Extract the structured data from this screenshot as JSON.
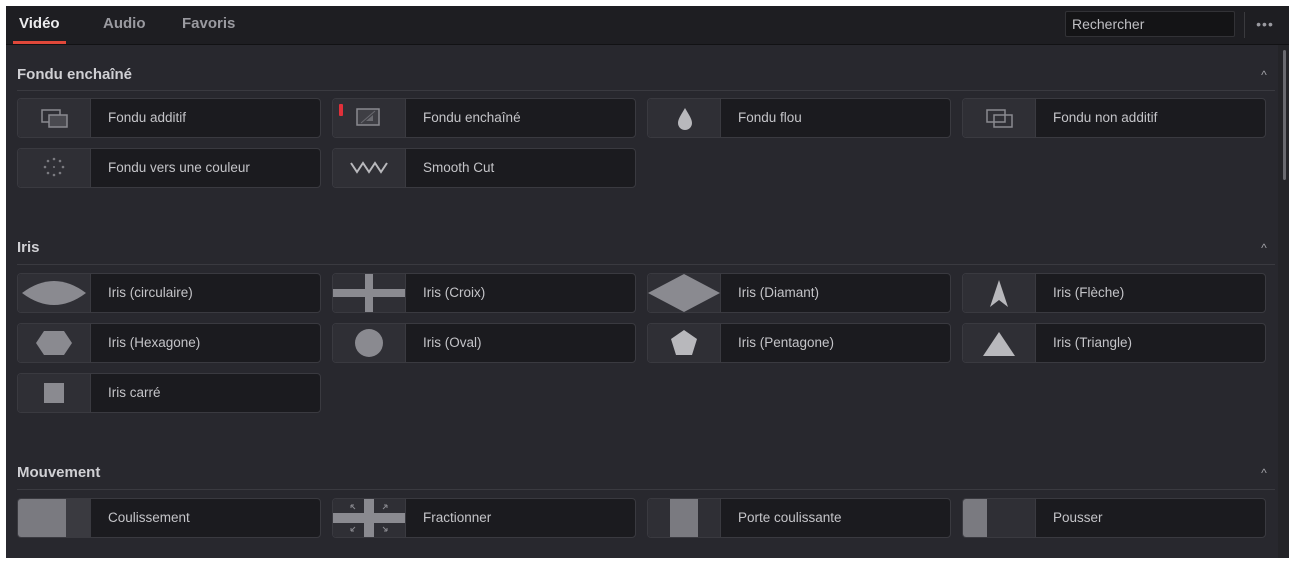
{
  "tabs": [
    {
      "label": "Vidéo",
      "active": true
    },
    {
      "label": "Audio",
      "active": false
    },
    {
      "label": "Favoris",
      "active": false
    }
  ],
  "search": {
    "value": "Rechercher"
  },
  "more_label": "•••",
  "accent": "#e0483a",
  "sections": [
    {
      "title": "Fondu enchaîné",
      "collapse_glyph": "^",
      "items": [
        {
          "label": "Fondu additif",
          "icon": "additive-dissolve-icon"
        },
        {
          "label": "Fondu enchaîné",
          "icon": "cross-dissolve-icon"
        },
        {
          "label": "Fondu flou",
          "icon": "drop-icon"
        },
        {
          "label": "Fondu non additif",
          "icon": "non-additive-dissolve-icon"
        },
        {
          "label": "Fondu vers une couleur",
          "icon": "dots-icon"
        },
        {
          "label": "Smooth Cut",
          "icon": "wave-icon"
        }
      ]
    },
    {
      "title": "Iris",
      "collapse_glyph": "^",
      "items": [
        {
          "label": "Iris (circulaire)",
          "icon": "eye-shape-icon"
        },
        {
          "label": "Iris (Croix)",
          "icon": "cross-shape-icon"
        },
        {
          "label": "Iris (Diamant)",
          "icon": "diamond-shape-icon"
        },
        {
          "label": "Iris (Flèche)",
          "icon": "arrow-shape-icon"
        },
        {
          "label": "Iris (Hexagone)",
          "icon": "hexagon-shape-icon"
        },
        {
          "label": "Iris (Oval)",
          "icon": "circle-shape-icon"
        },
        {
          "label": "Iris (Pentagone)",
          "icon": "pentagon-shape-icon"
        },
        {
          "label": "Iris (Triangle)",
          "icon": "triangle-shape-icon"
        },
        {
          "label": "Iris carré",
          "icon": "square-shape-icon"
        }
      ]
    },
    {
      "title": "Mouvement",
      "collapse_glyph": "^",
      "items": [
        {
          "label": "Coulissement",
          "icon": "slide-icon"
        },
        {
          "label": "Fractionner",
          "icon": "split-icon"
        },
        {
          "label": "Porte coulissante",
          "icon": "sliding-door-icon"
        },
        {
          "label": "Pousser",
          "icon": "push-icon"
        }
      ]
    }
  ]
}
